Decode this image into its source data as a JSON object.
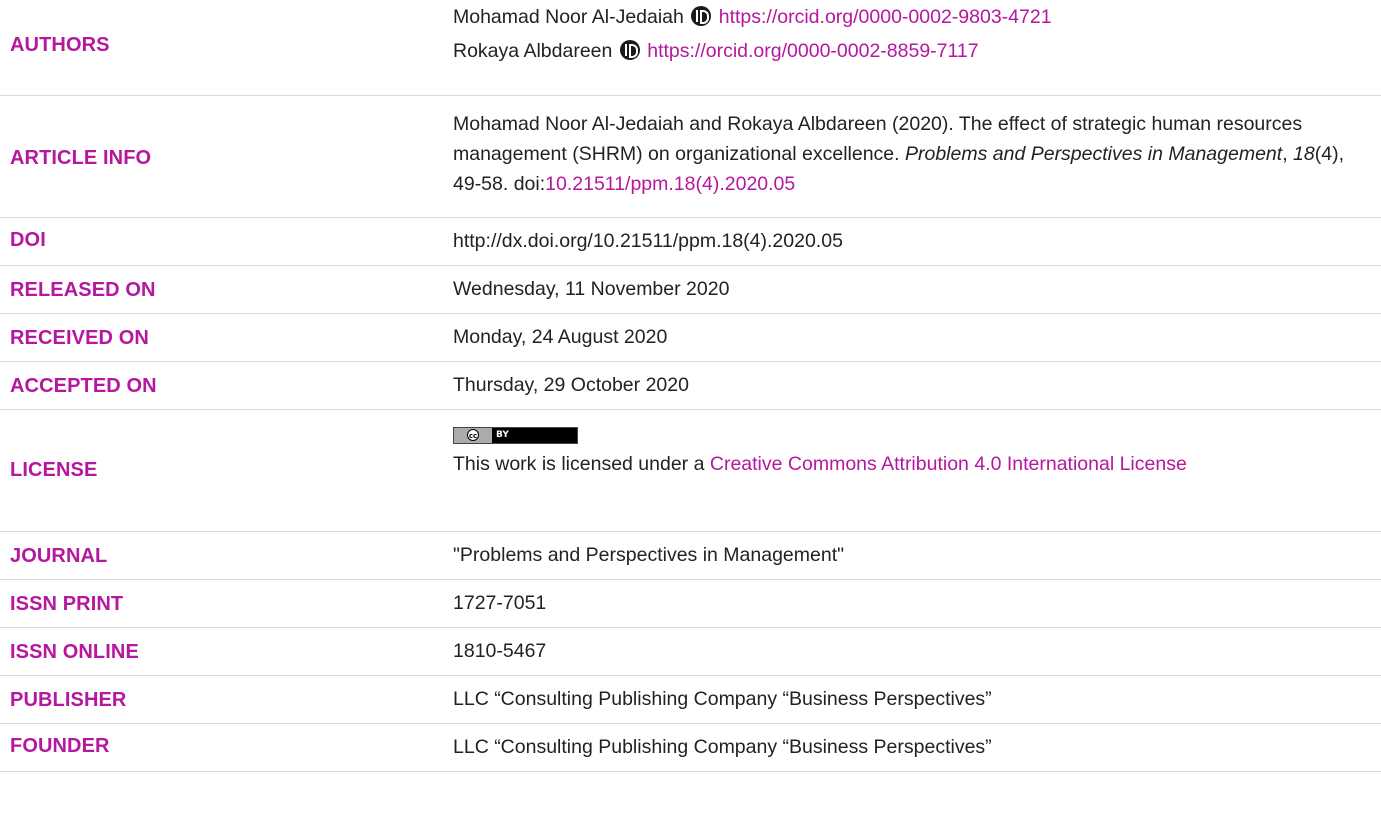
{
  "rows": {
    "authors": {
      "label": "AUTHORS",
      "items": [
        {
          "name": "Mohamad Noor Al-Jedaiah",
          "orcid": "https://orcid.org/0000-0002-9803-4721"
        },
        {
          "name": "Rokaya Albdareen",
          "orcid": "https://orcid.org/0000-0002-8859-7117"
        }
      ]
    },
    "article_info": {
      "label": "ARTICLE INFO",
      "part1": "Mohamad Noor Al-Jedaiah and Rokaya Albdareen (2020). The effect of strategic human resources management (SHRM) on organizational excellence. ",
      "journal_italic": "Problems and Perspectives in Management",
      "part2": ", ",
      "volume_italic": "18",
      "part3": "(4), 49-58. doi:",
      "doi_link": "10.21511/ppm.18(4).2020.05"
    },
    "doi": {
      "label": "DOI",
      "value": "http://dx.doi.org/10.21511/ppm.18(4).2020.05"
    },
    "released_on": {
      "label": "RELEASED ON",
      "value": "Wednesday, 11 November 2020"
    },
    "received_on": {
      "label": "RECEIVED ON",
      "value": "Monday, 24 August 2020"
    },
    "accepted_on": {
      "label": "ACCEPTED ON",
      "value": "Thursday, 29 October 2020"
    },
    "license": {
      "label": "LICENSE",
      "badge_cc": "cc",
      "badge_by": "BY",
      "text": "This work is licensed under a ",
      "link": "Creative Commons Attribution 4.0 International License"
    },
    "journal": {
      "label": "JOURNAL",
      "value": "\"Problems and Perspectives in Management\""
    },
    "issn_print": {
      "label": "ISSN PRINT",
      "value": "1727-7051"
    },
    "issn_online": {
      "label": "ISSN ONLINE",
      "value": "1810-5467"
    },
    "publisher": {
      "label": "PUBLISHER",
      "value": "LLC “Consulting Publishing Company “Business Perspectives”"
    },
    "founder": {
      "label": "FOUNDER",
      "value": "LLC “Consulting Publishing Company “Business Perspectives”"
    }
  },
  "colors": {
    "accent": "#b5179e",
    "text": "#222222",
    "divider": "#d9d9d9"
  },
  "icons": {
    "orcid": "orcid-icon",
    "license_badge": "cc-by-badge"
  }
}
